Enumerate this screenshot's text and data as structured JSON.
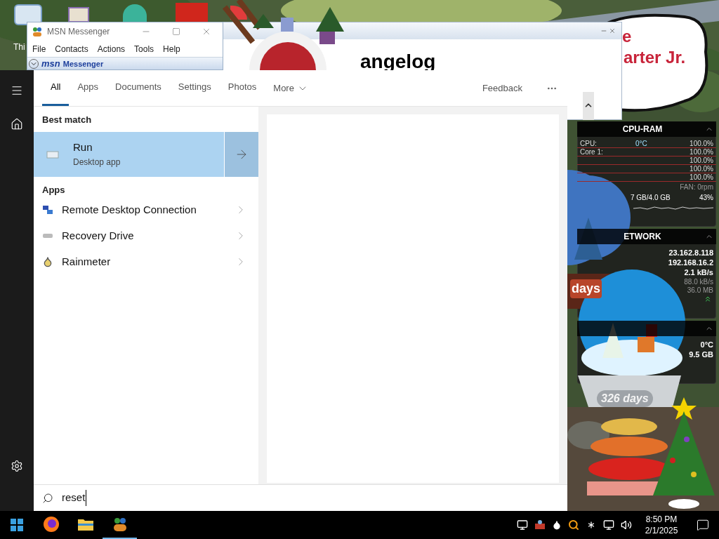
{
  "desktop": {
    "icon_label": "Thi"
  },
  "msn_window": {
    "title": "MSN Messenger",
    "menu": [
      "File",
      "Contacts",
      "Actions",
      "Tools",
      "Help"
    ],
    "banner_logo": "msn",
    "banner_title": "Messenger"
  },
  "changelog_window": {
    "heading": "angelog"
  },
  "speech_bubble": {
    "lines": [
      "e",
      "arter Jr."
    ]
  },
  "system_monitor": {
    "sections": [
      {
        "title": "CPU-RAM",
        "rows": [
          {
            "kind": "metric",
            "label": "CPU:",
            "middle": "0°C",
            "value": "100.0%"
          },
          {
            "kind": "metric",
            "label": "Core 1:",
            "value": "100.0%"
          },
          {
            "kind": "metric",
            "value": "100.0%"
          },
          {
            "kind": "metric",
            "value": "100.0%"
          },
          {
            "kind": "metric",
            "value": "100.0%"
          },
          {
            "kind": "info",
            "value": "FAN: 0rpm"
          },
          {
            "kind": "memory",
            "label": "7 GB/4.0 GB",
            "value": "43%"
          }
        ]
      },
      {
        "title": "ETWORK",
        "rows": [
          {
            "kind": "value",
            "value": "23.162.8.118"
          },
          {
            "kind": "value",
            "value": "192.168.16.2"
          },
          {
            "kind": "value",
            "value": "2.1 kB/s"
          },
          {
            "kind": "info",
            "value": "88.0 kB/s"
          },
          {
            "kind": "info",
            "value": "36.0 MB"
          }
        ]
      },
      {
        "rows": [
          {
            "kind": "value",
            "value": "0°C"
          },
          {
            "kind": "value",
            "value": "9.5 GB"
          }
        ]
      }
    ]
  },
  "gadget": {
    "banner": "days",
    "counter": "326 days"
  },
  "start_menu": {
    "tabs": [
      {
        "label": "All",
        "selected": true
      },
      {
        "label": "Apps",
        "selected": false
      },
      {
        "label": "Documents",
        "selected": false
      },
      {
        "label": "Settings",
        "selected": false
      },
      {
        "label": "Photos",
        "selected": false
      }
    ],
    "more": "More",
    "feedback": "Feedback",
    "best_match_heading": "Best match",
    "best_match": {
      "name": "Run",
      "subtitle": "Desktop app",
      "selected": true
    },
    "apps_heading": "Apps",
    "apps": [
      {
        "first": "R",
        "rest": "emote Desktop Connection"
      },
      {
        "first": "R",
        "rest": "ecovery Drive"
      },
      {
        "first": "R",
        "rest": "ainmeter"
      }
    ],
    "search": {
      "value": "reset"
    }
  },
  "taskbar": {
    "pinned": [
      {
        "kind": "firefox",
        "running": false
      },
      {
        "kind": "folder",
        "running": false
      },
      {
        "kind": "messenger",
        "running": true
      }
    ],
    "time": "8:50 PM",
    "date": "2/1/2025"
  }
}
